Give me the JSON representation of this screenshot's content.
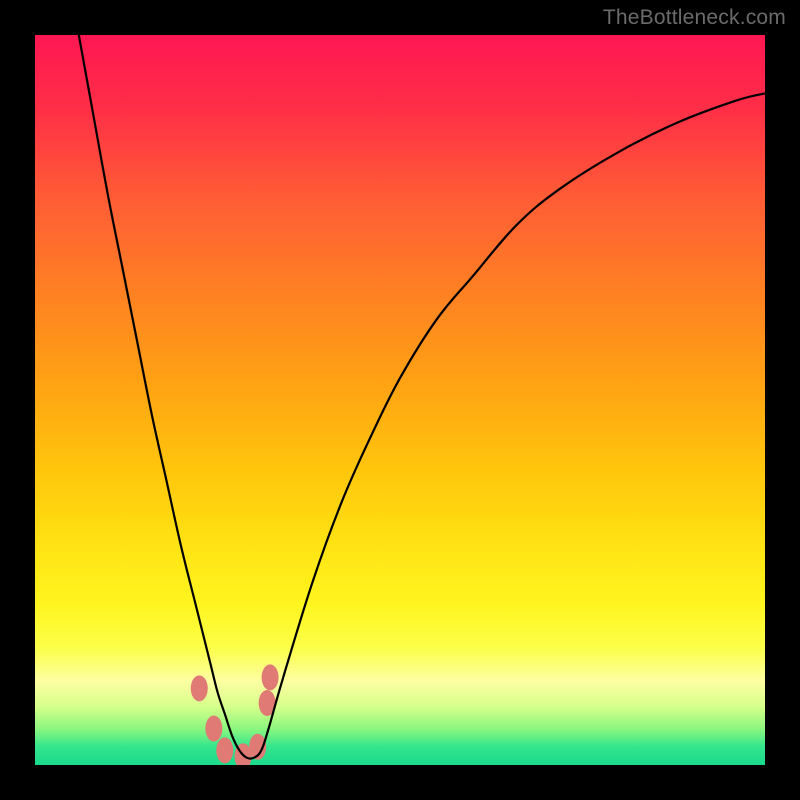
{
  "watermark": "TheBottleneck.com",
  "chart_data": {
    "type": "line",
    "title": "",
    "xlabel": "",
    "ylabel": "",
    "xlim": [
      0,
      100
    ],
    "ylim": [
      0,
      100
    ],
    "grid": false,
    "legend": false,
    "annotations": [],
    "series": [
      {
        "name": "curve",
        "color": "#000000",
        "x": [
          6,
          8,
          10,
          12,
          14,
          16,
          18,
          20,
          22,
          24,
          25,
          26,
          27,
          28,
          29,
          30,
          31,
          32,
          34,
          38,
          42,
          46,
          50,
          55,
          60,
          66,
          72,
          80,
          88,
          96,
          100
        ],
        "y": [
          100,
          89,
          78,
          68,
          58,
          48,
          39,
          30,
          22,
          14,
          10,
          7,
          4,
          2,
          1,
          1,
          2,
          5,
          12,
          25,
          36,
          45,
          53,
          61,
          67,
          74,
          79,
          84,
          88,
          91,
          92
        ]
      },
      {
        "name": "markers",
        "color": "#e07a74",
        "type": "scatter",
        "x": [
          22.5,
          24.5,
          26.0,
          28.5,
          30.5,
          31.8,
          32.2
        ],
        "y": [
          10.5,
          5.0,
          2.0,
          1.2,
          2.5,
          8.5,
          12.0
        ]
      }
    ],
    "background_gradient": {
      "stops": [
        {
          "pos": 0.0,
          "color": "#ff1752"
        },
        {
          "pos": 0.1,
          "color": "#ff2e47"
        },
        {
          "pos": 0.22,
          "color": "#ff5b36"
        },
        {
          "pos": 0.35,
          "color": "#ff8023"
        },
        {
          "pos": 0.48,
          "color": "#ffa313"
        },
        {
          "pos": 0.6,
          "color": "#ffc70c"
        },
        {
          "pos": 0.7,
          "color": "#ffe313"
        },
        {
          "pos": 0.78,
          "color": "#fff51f"
        },
        {
          "pos": 0.84,
          "color": "#fbff49"
        },
        {
          "pos": 0.885,
          "color": "#fdffa2"
        },
        {
          "pos": 0.92,
          "color": "#d6ff8c"
        },
        {
          "pos": 0.95,
          "color": "#8cf77e"
        },
        {
          "pos": 0.975,
          "color": "#34e58d"
        },
        {
          "pos": 1.0,
          "color": "#19da8c"
        }
      ]
    }
  }
}
